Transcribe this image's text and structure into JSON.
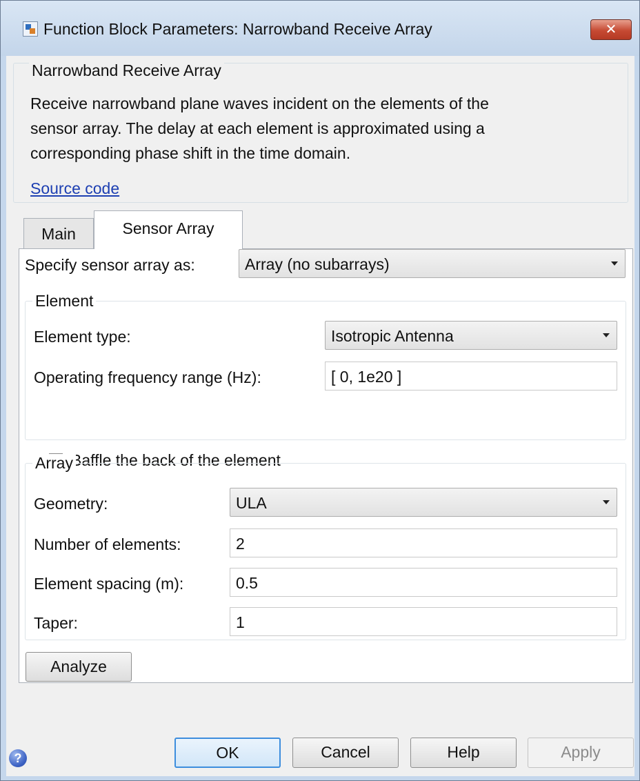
{
  "window": {
    "title": "Function Block Parameters: Narrowband Receive Array",
    "close_label": "✕"
  },
  "description": {
    "group_title": "Narrowband Receive Array",
    "line1": "Receive narrowband plane waves incident on the elements of the",
    "line2": "sensor array. The delay at each element is approximated using a",
    "line3": "corresponding phase shift in the time domain.",
    "source_link": "Source code"
  },
  "tabs": [
    {
      "label": "Main",
      "active": false
    },
    {
      "label": "Sensor Array",
      "active": true
    }
  ],
  "sensor_array": {
    "specify_label": "Specify sensor array as:",
    "specify_value": "Array (no subarrays)"
  },
  "element": {
    "group_title": "Element",
    "type_label": "Element type:",
    "type_value": "Isotropic Antenna",
    "freq_label": "Operating frequency range (Hz):",
    "freq_value": "[ 0, 1e20 ]",
    "baffle_label": "Baffle the back of the element",
    "baffle_checked": false
  },
  "array": {
    "group_title": "Array",
    "geometry_label": "Geometry:",
    "geometry_value": "ULA",
    "num_elements_label": "Number of elements:",
    "num_elements_value": "2",
    "spacing_label": "Element spacing (m):",
    "spacing_value": "0.5",
    "taper_label": "Taper:",
    "taper_value": "1"
  },
  "buttons": {
    "analyze": "Analyze",
    "ok": "OK",
    "cancel": "Cancel",
    "help": "Help",
    "apply": "Apply"
  },
  "icons": {
    "app": "simulink-block-icon",
    "help": "question-circle-icon"
  },
  "colors": {
    "titlebar": "#c8d9ed",
    "close_button": "#c64a33",
    "link": "#1d3fb2",
    "default_button_border": "#3c8ddd"
  }
}
